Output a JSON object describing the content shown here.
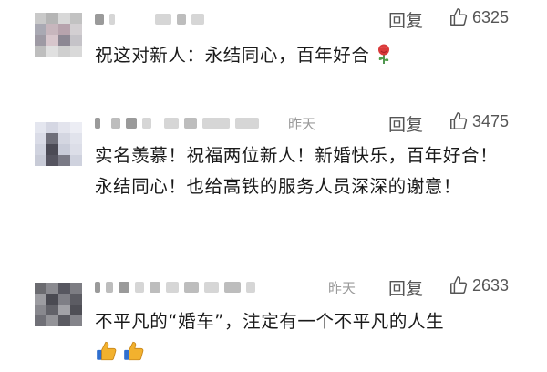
{
  "comments": [
    {
      "date": "",
      "reply_label": "回复",
      "likes": "6325",
      "text": "祝这对新人：永结同心，百年好合",
      "emoji": "rose-icon"
    },
    {
      "date": "昨天",
      "reply_label": "回复",
      "likes": "3475",
      "text": "实名羡慕！祝福两位新人！新婚快乐，百年好合！永结同心！也给高铁的服务人员深深的谢意！",
      "emoji": ""
    },
    {
      "date": "昨天",
      "reply_label": "回复",
      "likes": "2633",
      "text": "不平凡的“婚车”，注定有一个不平凡的人生",
      "emoji": "thumbs-up-icon"
    }
  ],
  "colors": {
    "meta_text": "#9a9a9a",
    "action_text": "#555555",
    "body_text": "#1a1a1a",
    "rose": "#d93a3a",
    "thumb": "#f2b12e"
  }
}
